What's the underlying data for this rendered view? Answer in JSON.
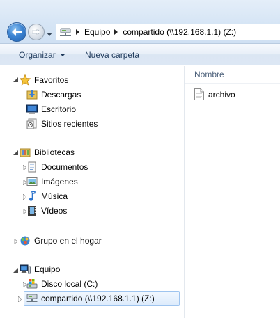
{
  "address": {
    "crumbs": [
      "Equipo",
      "compartido (\\\\192.168.1.1) (Z:)"
    ]
  },
  "commands": {
    "organize": "Organizar",
    "new_folder": "Nueva carpeta"
  },
  "tree": {
    "favorites": {
      "label": "Favoritos",
      "items": [
        "Descargas",
        "Escritorio",
        "Sitios recientes"
      ]
    },
    "libraries": {
      "label": "Bibliotecas",
      "items": [
        "Documentos",
        "Imágenes",
        "Música",
        "Vídeos"
      ]
    },
    "homegroup": {
      "label": "Grupo en el hogar"
    },
    "computer": {
      "label": "Equipo",
      "items": [
        "Disco local (C:)",
        "compartido (\\\\192.168.1.1) (Z:)"
      ]
    }
  },
  "content": {
    "column_name": "Nombre",
    "files": [
      "archivo"
    ]
  },
  "colors": {
    "accent": "#3c84d2",
    "selection_border": "#9ec4ef",
    "command_text": "#1e395b"
  }
}
